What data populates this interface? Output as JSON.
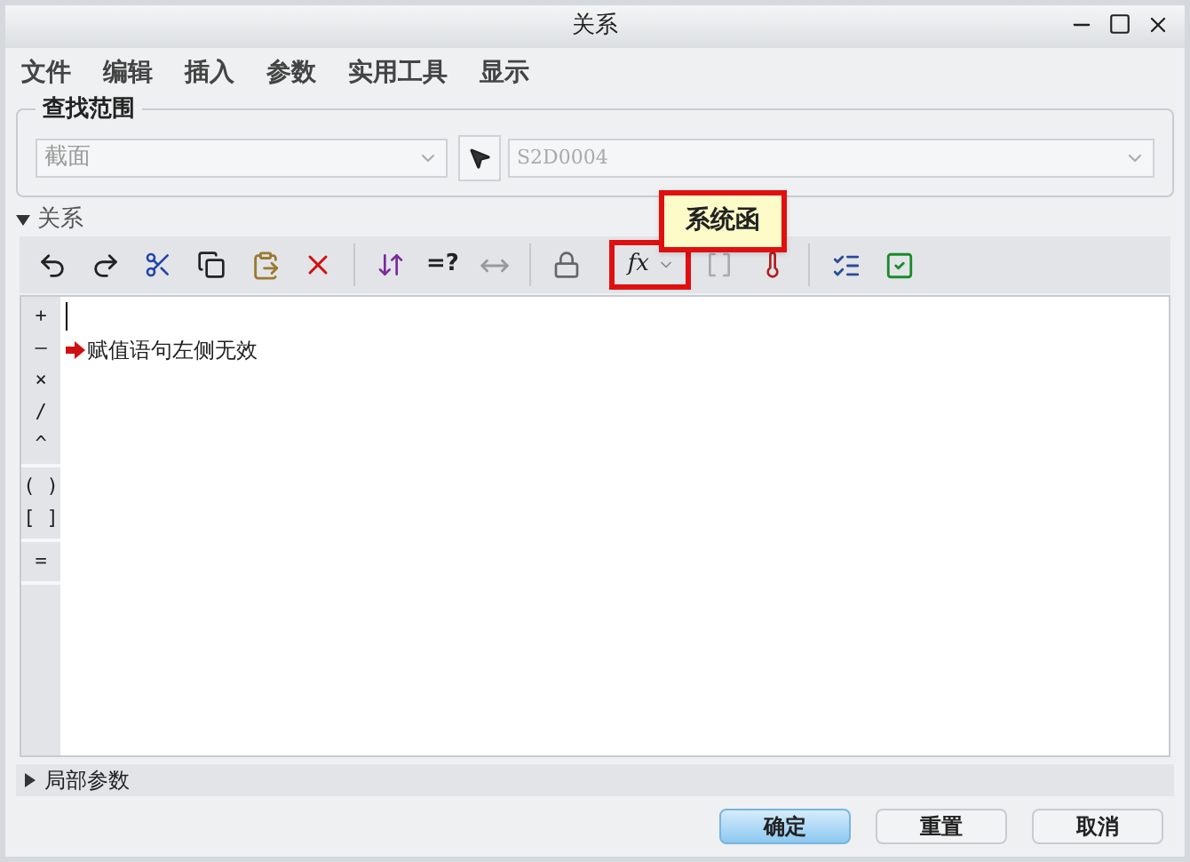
{
  "window": {
    "title": "关系"
  },
  "menu": [
    "文件",
    "编辑",
    "插入",
    "参数",
    "实用工具",
    "显示"
  ],
  "search_scope": {
    "label": "查找范围",
    "type_field": {
      "value": "截面",
      "disabled": true
    },
    "name_field": {
      "value": "S2D0004",
      "disabled": true
    }
  },
  "relations": {
    "label": "关系",
    "expanded": true
  },
  "toolbar": {
    "query_label": "=?",
    "function_label": "fx",
    "function_highlighted": true,
    "tooltip": "系统函"
  },
  "operator_groups": [
    [
      "+",
      "–",
      "×",
      "/",
      "^"
    ],
    [
      "( )",
      "[ ]"
    ],
    [
      "="
    ]
  ],
  "editor": {
    "messages": [
      "赋值语句左侧无效"
    ]
  },
  "local_params": {
    "label": "局部参数",
    "expanded": false
  },
  "buttons": [
    {
      "label": "确定",
      "default": true
    },
    {
      "label": "重置",
      "default": false
    },
    {
      "label": "取消",
      "default": false
    }
  ]
}
